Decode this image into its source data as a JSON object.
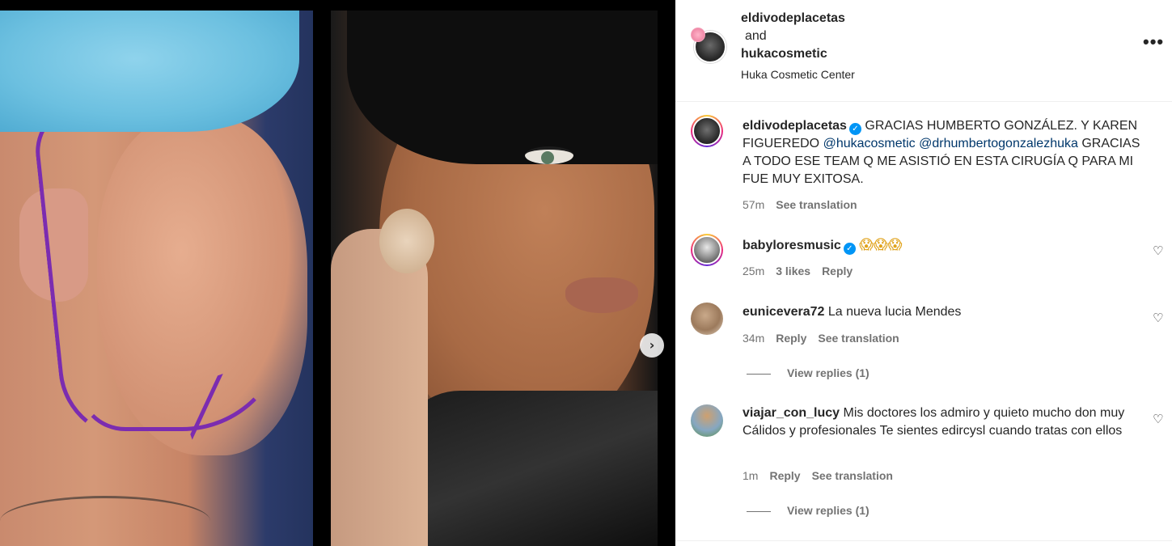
{
  "post": {
    "author": "eldivodeplacetas",
    "and_text": "and",
    "collaborator": "hukacosmetic",
    "location": "Huka Cosmetic Center",
    "more_icon": "more-horizontal-icon"
  },
  "media": {
    "next_icon": "chevron-right-icon",
    "next_glyph": "›"
  },
  "caption": {
    "username": "eldivodeplacetas",
    "verified_glyph": "✓",
    "text_1": "GRACIAS HUMBERTO GONZÁLEZ. Y KAREN FIGUEREDO",
    "mention_1": "@hukacosmetic",
    "mention_2": "@drhumbertogonzalezhuka",
    "text_2": "GRACIAS A TODO ESE TEAM Q ME ASISTIÓ EN ESTA CIRUGÍA Q PARA MI FUE MUY EXITOSA.",
    "time": "57m",
    "see_translation": "See translation"
  },
  "comments": [
    {
      "username": "babyloresmusic",
      "verified_glyph": "✓",
      "text": "😱😱😱",
      "time": "25m",
      "likes": "3 likes",
      "reply": "Reply",
      "heart_glyph": "♡"
    },
    {
      "username": "eunicevera72",
      "text": "La nueva lucia Mendes",
      "time": "34m",
      "reply": "Reply",
      "see_translation": "See translation",
      "heart_glyph": "♡",
      "view_replies": "View replies (1)"
    },
    {
      "username": "viajar_con_lucy",
      "text": "Mis doctores los admiro y quieto mucho don muy Cálidos y profesionales Te sientes edircysl cuando tratas con ellos",
      "time": "1m",
      "reply": "Reply",
      "see_translation": "See translation",
      "heart_glyph": "♡",
      "view_replies": "View replies (1)"
    }
  ],
  "colors": {
    "link": "#00376b",
    "verified": "#0095f6",
    "meta": "#737373",
    "text": "#262626"
  }
}
